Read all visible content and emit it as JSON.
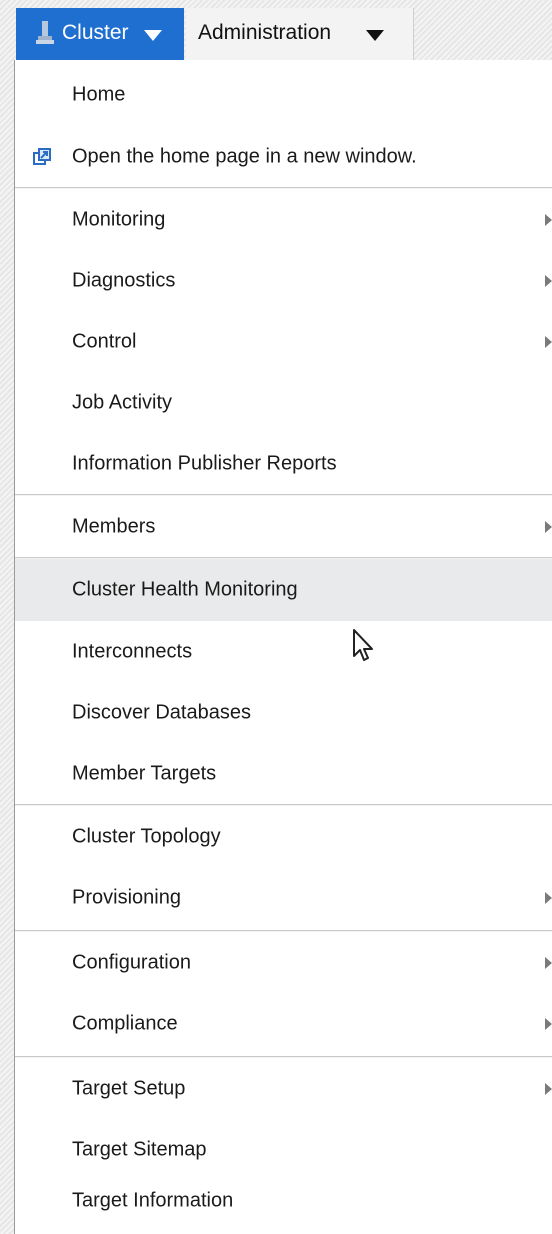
{
  "menubar": {
    "cluster_label": "Cluster",
    "administration_label": "Administration",
    "cluster_icon": "target-icon",
    "accent_color": "#1f6fd0"
  },
  "dropdown": {
    "items": [
      {
        "label": "Home"
      },
      {
        "label": "Open the home page in a new window.",
        "icon": "new-window-icon"
      },
      {
        "label": "Monitoring",
        "submenu": true
      },
      {
        "label": "Diagnostics",
        "submenu": true
      },
      {
        "label": "Control",
        "submenu": true
      },
      {
        "label": "Job Activity"
      },
      {
        "label": "Information Publisher Reports"
      },
      {
        "label": "Members",
        "submenu": true
      },
      {
        "label": "Cluster Health Monitoring",
        "highlighted": true
      },
      {
        "label": "Interconnects"
      },
      {
        "label": "Discover Databases"
      },
      {
        "label": "Member Targets"
      },
      {
        "label": "Cluster Topology"
      },
      {
        "label": "Provisioning",
        "submenu": true
      },
      {
        "label": "Configuration",
        "submenu": true
      },
      {
        "label": "Compliance",
        "submenu": true
      },
      {
        "label": "Target Setup",
        "submenu": true
      },
      {
        "label": "Target Sitemap"
      },
      {
        "label": "Target Information"
      }
    ]
  }
}
